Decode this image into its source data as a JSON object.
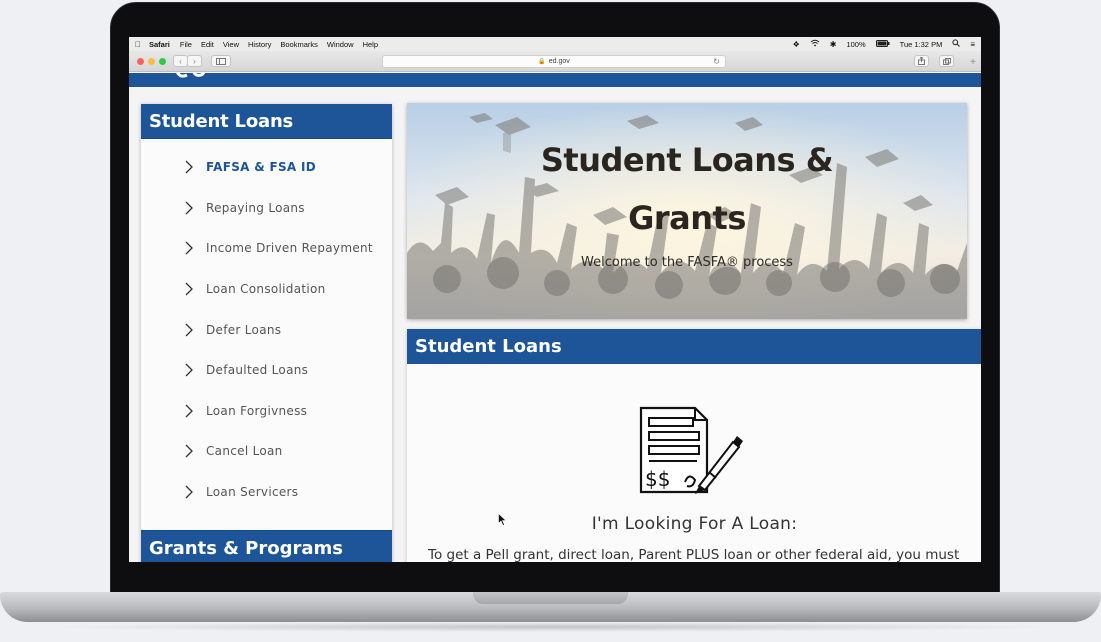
{
  "mac_menu": {
    "app": "Safari",
    "items": [
      "File",
      "Edit",
      "View",
      "History",
      "Bookmarks",
      "Window",
      "Help"
    ],
    "battery": "100%",
    "clock": "Tue 1:32 PM"
  },
  "browser": {
    "url": "ed.gov"
  },
  "sidebar": {
    "title": "Student Loans",
    "items": [
      {
        "label": "FAFSA & FSA ID",
        "active": true
      },
      {
        "label": "Repaying Loans"
      },
      {
        "label": "Income Driven Repayment"
      },
      {
        "label": "Loan Consolidation"
      },
      {
        "label": "Defer Loans"
      },
      {
        "label": "Defaulted Loans"
      },
      {
        "label": "Loan Forgivness"
      },
      {
        "label": "Cancel Loan"
      },
      {
        "label": "Loan Servicers"
      }
    ],
    "section2_title": "Grants & Programs"
  },
  "hero": {
    "title_line1": "Student Loans &",
    "title_line2": "Grants",
    "subtitle": "Welcome to the FASFA® process"
  },
  "content": {
    "title": "Student Loans",
    "icon": "loan-document-signature-icon",
    "heading": "I'm Looking For A Loan:",
    "paragraph": "To get a Pell grant, direct loan, Parent PLUS loan or other federal aid, you must"
  },
  "colors": {
    "brand_blue": "#1e5598",
    "active_link": "#1e5598"
  }
}
